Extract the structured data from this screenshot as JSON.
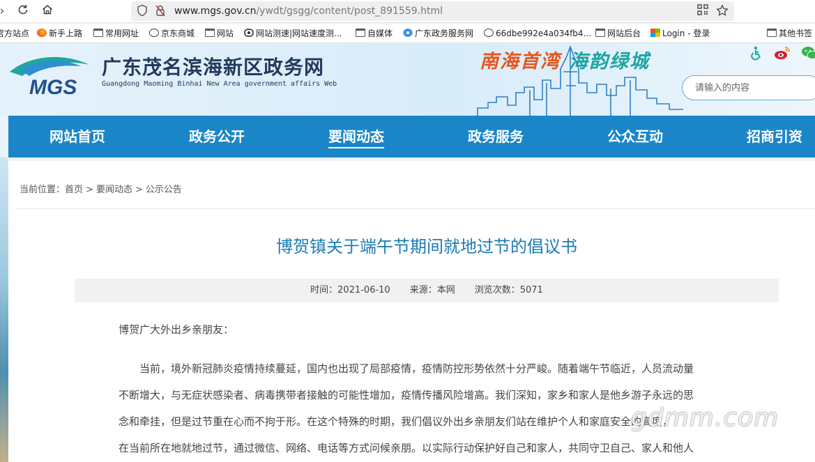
{
  "browser": {
    "url_domain": "www.mgs.gov.cn",
    "url_path": "/ywdt/gsgg/content/post_891559.html",
    "bookmarks": [
      {
        "label": "官方站点",
        "icon": "partial-item"
      },
      {
        "label": "新手上路",
        "icon": "firefox-icon"
      },
      {
        "label": "常用网址",
        "icon": "folder-icon"
      },
      {
        "label": "京东商城",
        "icon": "globe-icon"
      },
      {
        "label": "网站",
        "icon": "folder-icon"
      },
      {
        "label": "网站测速|网站速度测...",
        "icon": "eye-icon"
      },
      {
        "label": "自媒体",
        "icon": "folder-icon"
      },
      {
        "label": "广东政务服务网",
        "icon": "flower-icon"
      },
      {
        "label": "66dbe992e4a034fb4...",
        "icon": "globe-icon"
      },
      {
        "label": "网站后台",
        "icon": "folder-icon"
      },
      {
        "label": "Login - 登录",
        "icon": "windows-icon"
      },
      {
        "label": "其他书签",
        "icon": "folder-icon"
      }
    ]
  },
  "header": {
    "logo_text": "MGS",
    "title": "广东茂名滨海新区政务网",
    "subtitle": "Guangdong Maoming Binhai New Area government affairs Web",
    "slogan_part1": "南海首湾",
    "slogan_part2": "海韵绿城",
    "search_placeholder": "请输入的内容",
    "colors": {
      "accent": "#1a86c8",
      "title": "#233a5c",
      "slogan1": "#e8551b",
      "slogan2": "#1aa5a0"
    }
  },
  "nav": {
    "items": [
      "网站首页",
      "政务公开",
      "要闻动态",
      "政务服务",
      "公众互动",
      "招商引资"
    ],
    "active": "要闻动态"
  },
  "breadcrumb": {
    "prefix": "当前位置：",
    "items": [
      "首页",
      "要闻动态",
      "公示公告"
    ],
    "separator": ">"
  },
  "article": {
    "title": "博贺镇关于端午节期间就地过节的倡议书",
    "meta": {
      "time": "时间：2021-06-10",
      "source": "来源：本网",
      "views": "浏览次数：5071"
    },
    "greeting": "博贺广大外出乡亲朋友：",
    "lines": [
      "当前，境外新冠肺炎疫情持续蔓延，国内也出现了局部疫情，疫情防控形势依然十分严峻。随着端午节临近，人员流动量",
      "不断增大，与无症状感染者、病毒携带者接触的可能性增加，疫情传播风险增高。我们深知，家乡和家人是他乡游子永远的思",
      "念和牵挂，但是过节重在心而不拘于形。在这个特殊的时期，我们倡议外出乡亲朋友们站在维护个人和家庭安全的高度，",
      "在当前所在地就地过节，通过微信、网络、电话等方式问候亲朋。以实际行动保护好自己和家人，共同守卫自己、家人和他人"
    ]
  },
  "watermark": "gdmm.com"
}
